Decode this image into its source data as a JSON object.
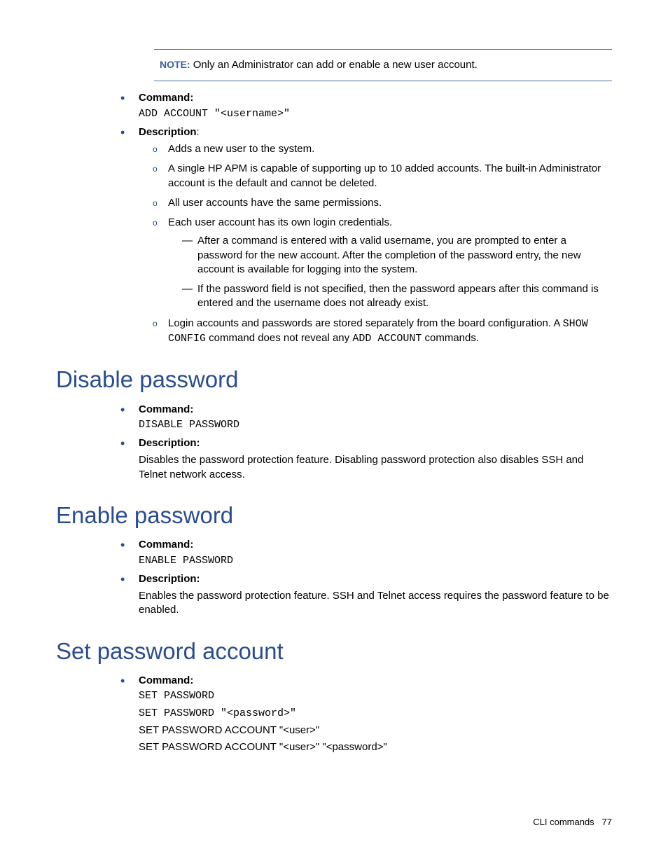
{
  "note": {
    "label": "NOTE:",
    "text": "Only an Administrator can add or enable a new user account."
  },
  "addAccount": {
    "commandLabel": "Command:",
    "command": "ADD ACCOUNT \"<username>\"",
    "descLabel": "Description",
    "desc1": "Adds a new user to the system.",
    "desc2": "A single HP APM is capable of supporting up to 10 added accounts. The built-in Administrator account is the default and cannot be deleted.",
    "desc3": "All user accounts have the same permissions.",
    "desc4": "Each user account has its own login credentials.",
    "sub1": "After a command is entered with a valid username, you are prompted to enter a password for the new account. After the completion of the password entry, the new account is available for logging into the system.",
    "sub2": "If the password field is not specified, then the password appears after this command is entered and the username does not already exist.",
    "desc5a": "Login accounts and passwords are stored separately from the board configuration. A ",
    "desc5Mono1": "SHOW CONFIG",
    "desc5b": " command does not reveal any ",
    "desc5Mono2": "ADD ACCOUNT",
    "desc5c": " commands."
  },
  "disable": {
    "heading": "Disable password",
    "commandLabel": "Command:",
    "command": "DISABLE PASSWORD",
    "descLabel": "Description:",
    "desc": "Disables the password protection feature. Disabling password protection also disables SSH and Telnet network access."
  },
  "enable": {
    "heading": "Enable password",
    "commandLabel": "Command:",
    "command": "ENABLE PASSWORD",
    "descLabel": "Description:",
    "desc": "Enables the password protection feature. SSH and Telnet access requires the password feature to be enabled."
  },
  "setpw": {
    "heading": "Set password account",
    "commandLabel": "Command:",
    "cmd1": "SET PASSWORD",
    "cmd2": "SET PASSWORD \"<password>\"",
    "cmd3": "SET PASSWORD ACCOUNT \"<user>\"",
    "cmd4": "SET PASSWORD ACCOUNT \"<user>\" \"<password>\""
  },
  "footer": {
    "section": "CLI commands",
    "page": "77"
  }
}
